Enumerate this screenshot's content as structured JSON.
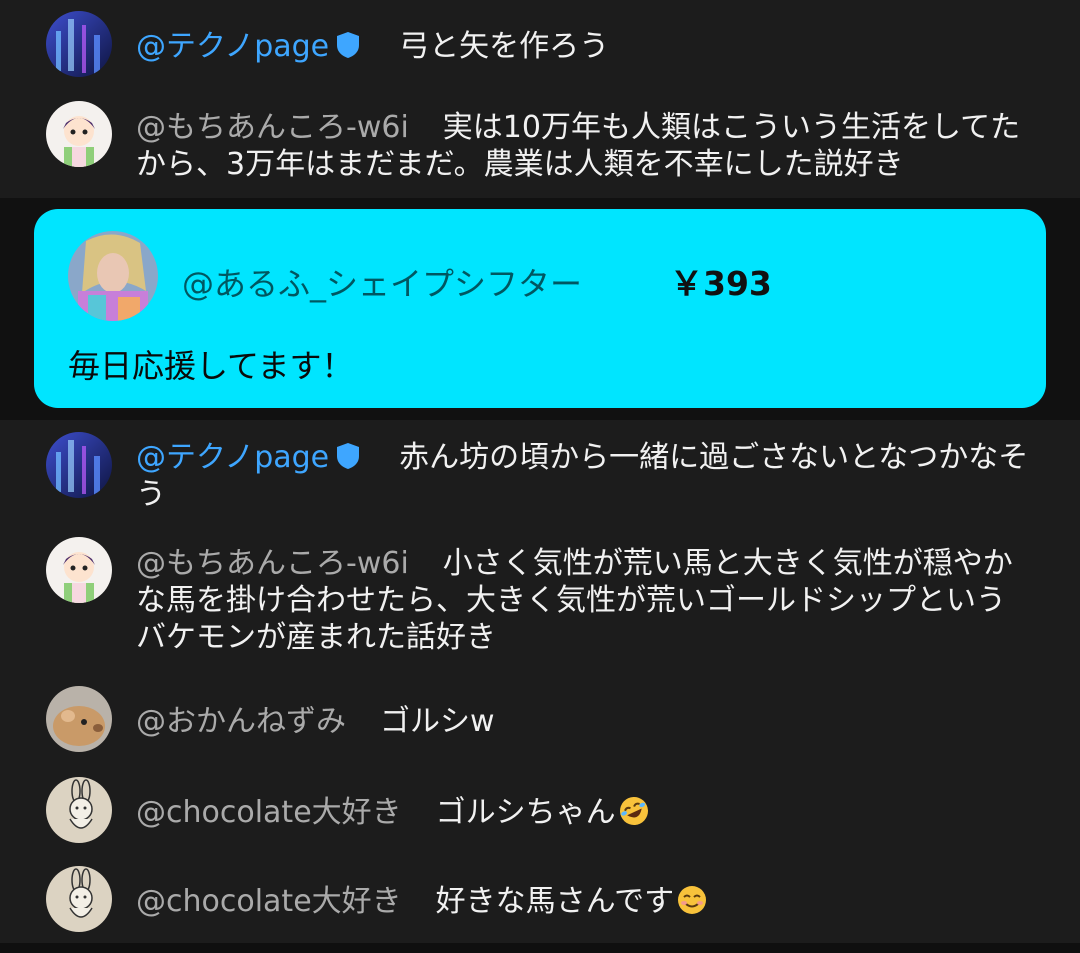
{
  "colors": {
    "background": "#1c1c1c",
    "owner_name": "#3ea6ff",
    "author_name": "#aaaaaa",
    "message_text": "#f1f1f1",
    "superchat_bg": "#00e5ff"
  },
  "messages": [
    {
      "author": "@テクノpage",
      "owner": true,
      "verified_icon": "verified-badge-icon",
      "text": "弓と矢を作ろう"
    },
    {
      "author": "@もちあんころ-w6i",
      "owner": false,
      "text": "実は10万年も人類はこういう生活をしてたから、3万年はまだまだ。農業は人類を不幸にした説好き"
    },
    {
      "author": "@テクノpage",
      "owner": true,
      "verified_icon": "verified-badge-icon",
      "text": "赤ん坊の頃から一緒に過ごさないとなつかなそう"
    },
    {
      "author": "@もちあんころ-w6i",
      "owner": false,
      "text": "小さく気性が荒い馬と大きく気性が穏やかな馬を掛け合わせたら、大きく気性が荒いゴールドシップというバケモンが産まれた話好き"
    },
    {
      "author": "@おかんねずみ",
      "owner": false,
      "text": "ゴルシw"
    },
    {
      "author": "@chocolate大好き",
      "owner": false,
      "text": "ゴルシちゃん",
      "emoji": "rofl-emoji-icon"
    },
    {
      "author": "@chocolate大好き",
      "owner": false,
      "text": "好きな馬さんです",
      "emoji": "smile-emoji-icon"
    }
  ],
  "superchat": {
    "author": "@あるふ_シェイプシフター",
    "amount": "￥393",
    "message": "毎日応援してます！"
  }
}
